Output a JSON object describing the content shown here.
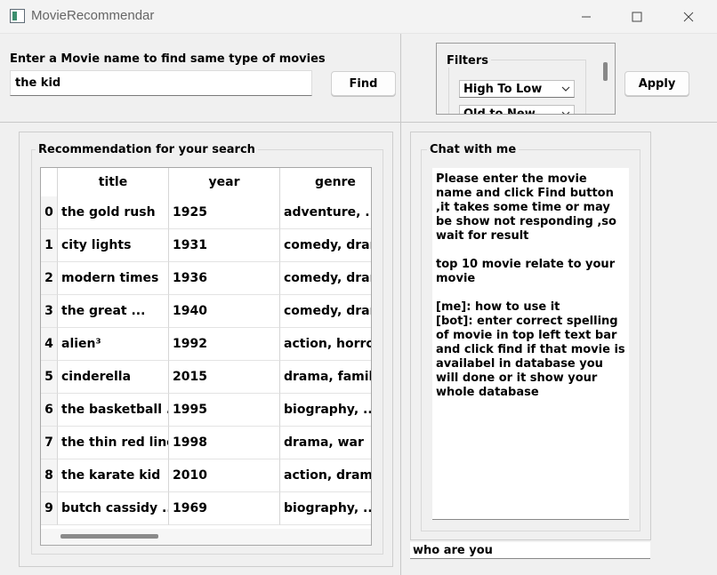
{
  "window": {
    "title": "MovieRecommendar",
    "minimize_glyph": "—",
    "maximize_glyph": "☐",
    "close_glyph": "✕"
  },
  "search": {
    "label": "Enter a Movie name to find same type of movies",
    "value": "the kid",
    "find_label": "Find"
  },
  "filters": {
    "title": "Filters",
    "sort_value": "High To Low",
    "date_value": "Old to New",
    "apply_label": "Apply"
  },
  "recommendations": {
    "group_title": "Recommendation for your search",
    "columns": [
      "title",
      "year",
      "genre"
    ],
    "rows": [
      {
        "index": "0",
        "title": "the gold rush",
        "year": "1925",
        "genre": "adventure, ..."
      },
      {
        "index": "1",
        "title": "city lights",
        "year": "1931",
        "genre": "comedy, drama"
      },
      {
        "index": "2",
        "title": "modern times",
        "year": "1936",
        "genre": "comedy, drama"
      },
      {
        "index": "3",
        "title": "the great ...",
        "year": "1940",
        "genre": "comedy, drama"
      },
      {
        "index": "4",
        "title": "alien³",
        "year": "1992",
        "genre": "action, horror,"
      },
      {
        "index": "5",
        "title": "cinderella",
        "year": "2015",
        "genre": "drama, family,"
      },
      {
        "index": "6",
        "title": "the basketball ...",
        "year": "1995",
        "genre": "biography, ..."
      },
      {
        "index": "7",
        "title": "the thin red line",
        "year": "1998",
        "genre": "drama, war"
      },
      {
        "index": "8",
        "title": "the karate kid",
        "year": "2010",
        "genre": "action, drama,"
      },
      {
        "index": "9",
        "title": "butch cassidy ...",
        "year": "1969",
        "genre": "biography, ..."
      }
    ]
  },
  "chat": {
    "group_title": "Chat with me",
    "log": "Please enter the movie name and click Find button ,it takes some time or may be show not responding ,so wait for result\n\ntop 10 movie relate to your movie\n\n[me]: how to use it\n[bot]: enter correct spelling of movie in top left text bar and click find if that movie is availabel in database you will done or it show your whole database",
    "input_value": "who are you"
  }
}
